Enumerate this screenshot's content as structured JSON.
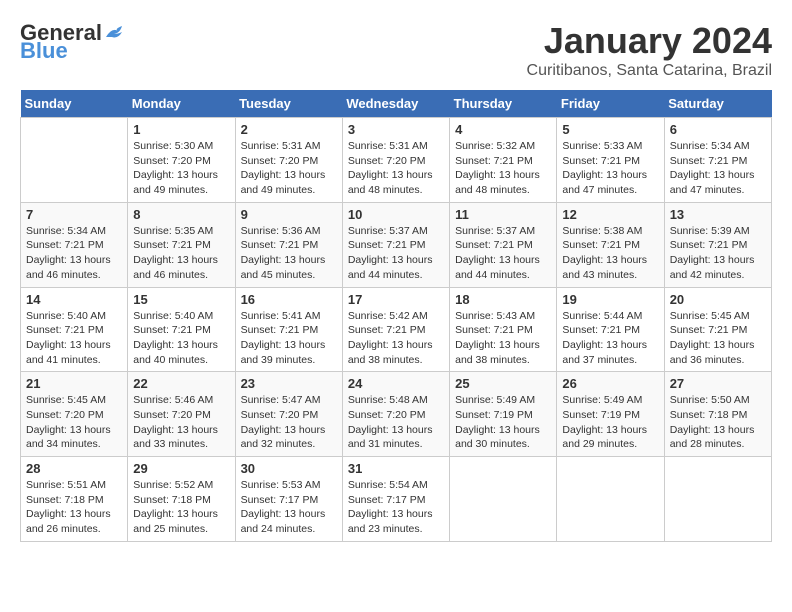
{
  "logo": {
    "general": "General",
    "blue": "Blue"
  },
  "header": {
    "month": "January 2024",
    "location": "Curitibanos, Santa Catarina, Brazil"
  },
  "weekdays": [
    "Sunday",
    "Monday",
    "Tuesday",
    "Wednesday",
    "Thursday",
    "Friday",
    "Saturday"
  ],
  "weeks": [
    [
      {
        "day": "",
        "sunrise": "",
        "sunset": "",
        "daylight": ""
      },
      {
        "day": "1",
        "sunrise": "Sunrise: 5:30 AM",
        "sunset": "Sunset: 7:20 PM",
        "daylight": "Daylight: 13 hours and 49 minutes."
      },
      {
        "day": "2",
        "sunrise": "Sunrise: 5:31 AM",
        "sunset": "Sunset: 7:20 PM",
        "daylight": "Daylight: 13 hours and 49 minutes."
      },
      {
        "day": "3",
        "sunrise": "Sunrise: 5:31 AM",
        "sunset": "Sunset: 7:20 PM",
        "daylight": "Daylight: 13 hours and 48 minutes."
      },
      {
        "day": "4",
        "sunrise": "Sunrise: 5:32 AM",
        "sunset": "Sunset: 7:21 PM",
        "daylight": "Daylight: 13 hours and 48 minutes."
      },
      {
        "day": "5",
        "sunrise": "Sunrise: 5:33 AM",
        "sunset": "Sunset: 7:21 PM",
        "daylight": "Daylight: 13 hours and 47 minutes."
      },
      {
        "day": "6",
        "sunrise": "Sunrise: 5:34 AM",
        "sunset": "Sunset: 7:21 PM",
        "daylight": "Daylight: 13 hours and 47 minutes."
      }
    ],
    [
      {
        "day": "7",
        "sunrise": "Sunrise: 5:34 AM",
        "sunset": "Sunset: 7:21 PM",
        "daylight": "Daylight: 13 hours and 46 minutes."
      },
      {
        "day": "8",
        "sunrise": "Sunrise: 5:35 AM",
        "sunset": "Sunset: 7:21 PM",
        "daylight": "Daylight: 13 hours and 46 minutes."
      },
      {
        "day": "9",
        "sunrise": "Sunrise: 5:36 AM",
        "sunset": "Sunset: 7:21 PM",
        "daylight": "Daylight: 13 hours and 45 minutes."
      },
      {
        "day": "10",
        "sunrise": "Sunrise: 5:37 AM",
        "sunset": "Sunset: 7:21 PM",
        "daylight": "Daylight: 13 hours and 44 minutes."
      },
      {
        "day": "11",
        "sunrise": "Sunrise: 5:37 AM",
        "sunset": "Sunset: 7:21 PM",
        "daylight": "Daylight: 13 hours and 44 minutes."
      },
      {
        "day": "12",
        "sunrise": "Sunrise: 5:38 AM",
        "sunset": "Sunset: 7:21 PM",
        "daylight": "Daylight: 13 hours and 43 minutes."
      },
      {
        "day": "13",
        "sunrise": "Sunrise: 5:39 AM",
        "sunset": "Sunset: 7:21 PM",
        "daylight": "Daylight: 13 hours and 42 minutes."
      }
    ],
    [
      {
        "day": "14",
        "sunrise": "Sunrise: 5:40 AM",
        "sunset": "Sunset: 7:21 PM",
        "daylight": "Daylight: 13 hours and 41 minutes."
      },
      {
        "day": "15",
        "sunrise": "Sunrise: 5:40 AM",
        "sunset": "Sunset: 7:21 PM",
        "daylight": "Daylight: 13 hours and 40 minutes."
      },
      {
        "day": "16",
        "sunrise": "Sunrise: 5:41 AM",
        "sunset": "Sunset: 7:21 PM",
        "daylight": "Daylight: 13 hours and 39 minutes."
      },
      {
        "day": "17",
        "sunrise": "Sunrise: 5:42 AM",
        "sunset": "Sunset: 7:21 PM",
        "daylight": "Daylight: 13 hours and 38 minutes."
      },
      {
        "day": "18",
        "sunrise": "Sunrise: 5:43 AM",
        "sunset": "Sunset: 7:21 PM",
        "daylight": "Daylight: 13 hours and 38 minutes."
      },
      {
        "day": "19",
        "sunrise": "Sunrise: 5:44 AM",
        "sunset": "Sunset: 7:21 PM",
        "daylight": "Daylight: 13 hours and 37 minutes."
      },
      {
        "day": "20",
        "sunrise": "Sunrise: 5:45 AM",
        "sunset": "Sunset: 7:21 PM",
        "daylight": "Daylight: 13 hours and 36 minutes."
      }
    ],
    [
      {
        "day": "21",
        "sunrise": "Sunrise: 5:45 AM",
        "sunset": "Sunset: 7:20 PM",
        "daylight": "Daylight: 13 hours and 34 minutes."
      },
      {
        "day": "22",
        "sunrise": "Sunrise: 5:46 AM",
        "sunset": "Sunset: 7:20 PM",
        "daylight": "Daylight: 13 hours and 33 minutes."
      },
      {
        "day": "23",
        "sunrise": "Sunrise: 5:47 AM",
        "sunset": "Sunset: 7:20 PM",
        "daylight": "Daylight: 13 hours and 32 minutes."
      },
      {
        "day": "24",
        "sunrise": "Sunrise: 5:48 AM",
        "sunset": "Sunset: 7:20 PM",
        "daylight": "Daylight: 13 hours and 31 minutes."
      },
      {
        "day": "25",
        "sunrise": "Sunrise: 5:49 AM",
        "sunset": "Sunset: 7:19 PM",
        "daylight": "Daylight: 13 hours and 30 minutes."
      },
      {
        "day": "26",
        "sunrise": "Sunrise: 5:49 AM",
        "sunset": "Sunset: 7:19 PM",
        "daylight": "Daylight: 13 hours and 29 minutes."
      },
      {
        "day": "27",
        "sunrise": "Sunrise: 5:50 AM",
        "sunset": "Sunset: 7:18 PM",
        "daylight": "Daylight: 13 hours and 28 minutes."
      }
    ],
    [
      {
        "day": "28",
        "sunrise": "Sunrise: 5:51 AM",
        "sunset": "Sunset: 7:18 PM",
        "daylight": "Daylight: 13 hours and 26 minutes."
      },
      {
        "day": "29",
        "sunrise": "Sunrise: 5:52 AM",
        "sunset": "Sunset: 7:18 PM",
        "daylight": "Daylight: 13 hours and 25 minutes."
      },
      {
        "day": "30",
        "sunrise": "Sunrise: 5:53 AM",
        "sunset": "Sunset: 7:17 PM",
        "daylight": "Daylight: 13 hours and 24 minutes."
      },
      {
        "day": "31",
        "sunrise": "Sunrise: 5:54 AM",
        "sunset": "Sunset: 7:17 PM",
        "daylight": "Daylight: 13 hours and 23 minutes."
      },
      {
        "day": "",
        "sunrise": "",
        "sunset": "",
        "daylight": ""
      },
      {
        "day": "",
        "sunrise": "",
        "sunset": "",
        "daylight": ""
      },
      {
        "day": "",
        "sunrise": "",
        "sunset": "",
        "daylight": ""
      }
    ]
  ]
}
